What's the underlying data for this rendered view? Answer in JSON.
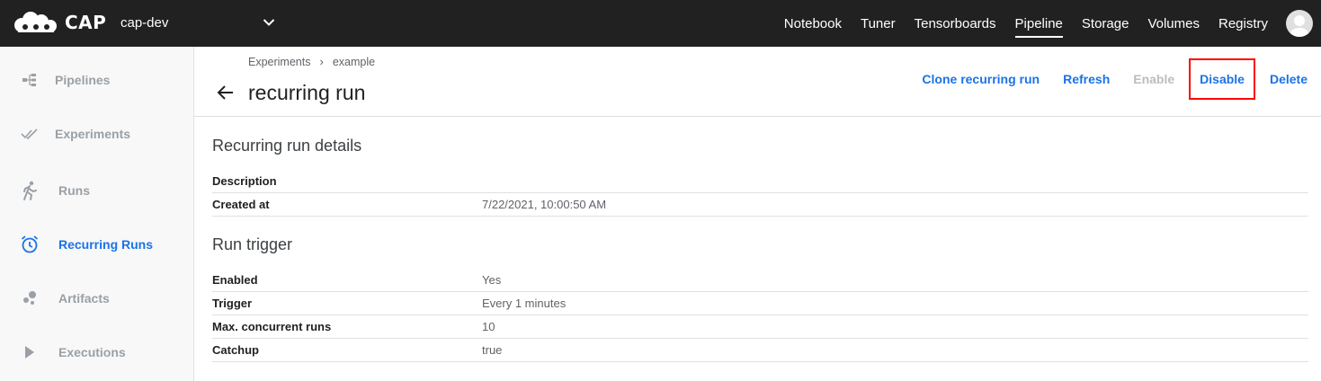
{
  "app": {
    "logo_text": "CAP",
    "namespace": "cap-dev"
  },
  "nav": {
    "items": [
      {
        "label": "Notebook",
        "active": false
      },
      {
        "label": "Tuner",
        "active": false
      },
      {
        "label": "Tensorboards",
        "active": false
      },
      {
        "label": "Pipeline",
        "active": true
      },
      {
        "label": "Storage",
        "active": false
      },
      {
        "label": "Volumes",
        "active": false
      },
      {
        "label": "Registry",
        "active": false
      }
    ]
  },
  "sidebar": {
    "items": [
      {
        "label": "Pipelines",
        "icon": "pipelines-icon",
        "active": false
      },
      {
        "label": "Experiments",
        "icon": "experiments-icon",
        "active": false
      },
      {
        "label": "Runs",
        "icon": "runs-icon",
        "active": false
      },
      {
        "label": "Recurring Runs",
        "icon": "alarm-clock-icon",
        "active": true
      },
      {
        "label": "Artifacts",
        "icon": "artifacts-icon",
        "active": false
      },
      {
        "label": "Executions",
        "icon": "play-icon",
        "active": false
      }
    ]
  },
  "header": {
    "breadcrumb": [
      "Experiments",
      "example"
    ],
    "breadcrumb_separator": "›",
    "title": "recurring run",
    "actions": {
      "clone": "Clone recurring run",
      "refresh": "Refresh",
      "enable": "Enable",
      "disable": "Disable",
      "delete": "Delete"
    }
  },
  "details": {
    "title": "Recurring run details",
    "rows": [
      {
        "key": "Description",
        "value": ""
      },
      {
        "key": "Created at",
        "value": "7/22/2021, 10:00:50 AM"
      }
    ]
  },
  "trigger": {
    "title": "Run trigger",
    "rows": [
      {
        "key": "Enabled",
        "value": "Yes"
      },
      {
        "key": "Trigger",
        "value": "Every 1 minutes"
      },
      {
        "key": "Max. concurrent runs",
        "value": "10"
      },
      {
        "key": "Catchup",
        "value": "true"
      }
    ]
  },
  "colors": {
    "topbar": "#212121",
    "accent": "#1a73e8",
    "sidebar_inactive": "#9aa0a6",
    "highlight": "#ff0000"
  }
}
